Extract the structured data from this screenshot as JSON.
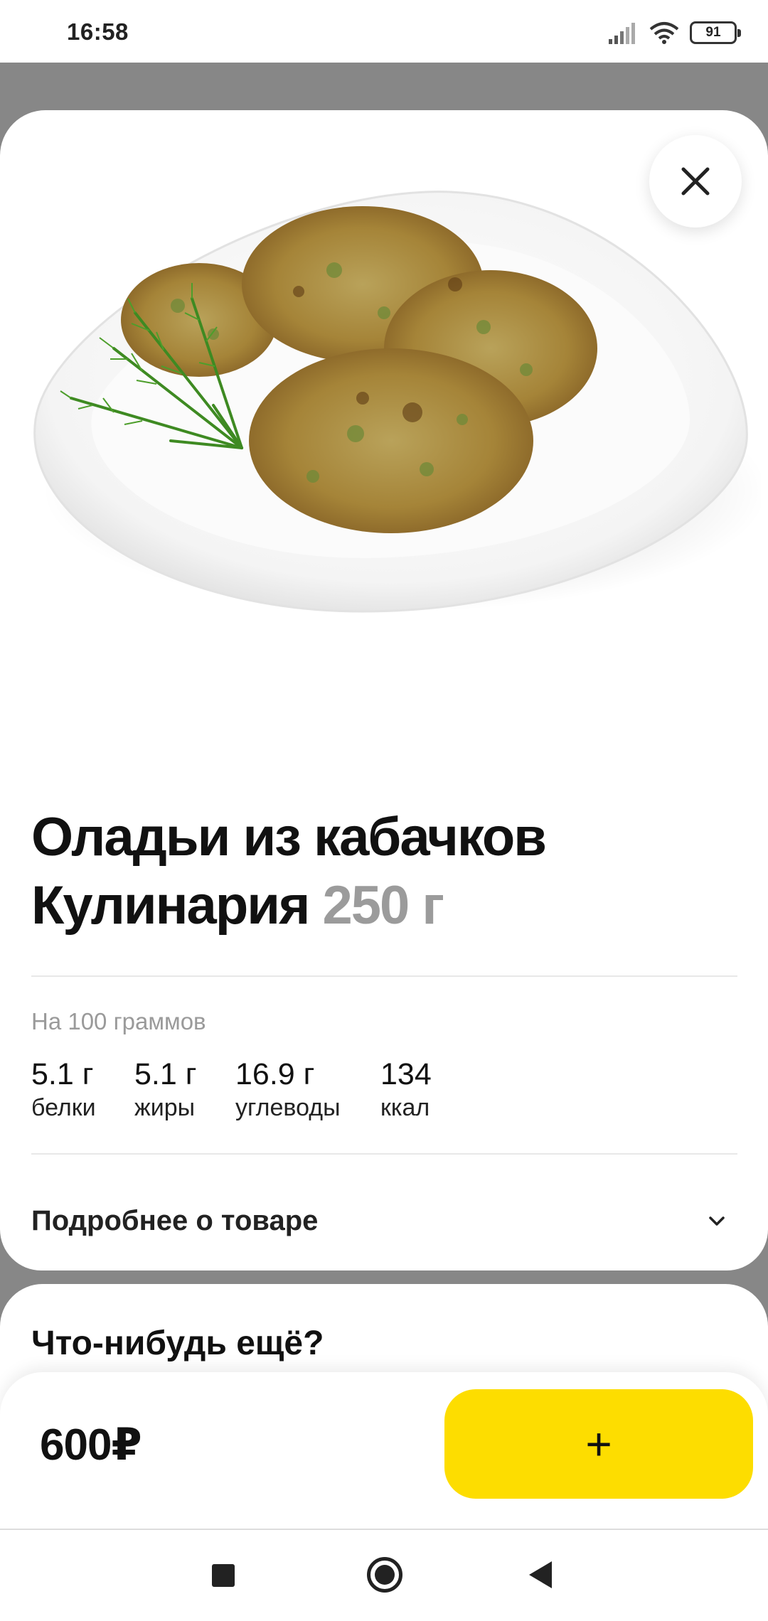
{
  "status_bar": {
    "time": "16:58",
    "battery": "91"
  },
  "product": {
    "title_line1": "Оладьи из кабачков",
    "title_line2": "Кулинария",
    "weight": "250 г",
    "image_icon": "zucchini-fritters-photo"
  },
  "nutrition": {
    "header": "На 100 граммов",
    "items": [
      {
        "value": "5.1 г",
        "label": "белки"
      },
      {
        "value": "5.1 г",
        "label": "жиры"
      },
      {
        "value": "16.9 г",
        "label": "углеводы"
      },
      {
        "value": "134",
        "label": "ккал"
      }
    ]
  },
  "details": {
    "label": "Подробнее о товаре"
  },
  "upsell": {
    "title": "Что-нибудь ещё?"
  },
  "purchase": {
    "price": "600₽",
    "add_label": "+",
    "accent_color": "#fddd00"
  },
  "icons": {
    "close": "close-icon",
    "chevron": "chevron-down-icon",
    "signal": "signal-icon",
    "wifi": "wifi-icon",
    "battery": "battery-icon"
  }
}
